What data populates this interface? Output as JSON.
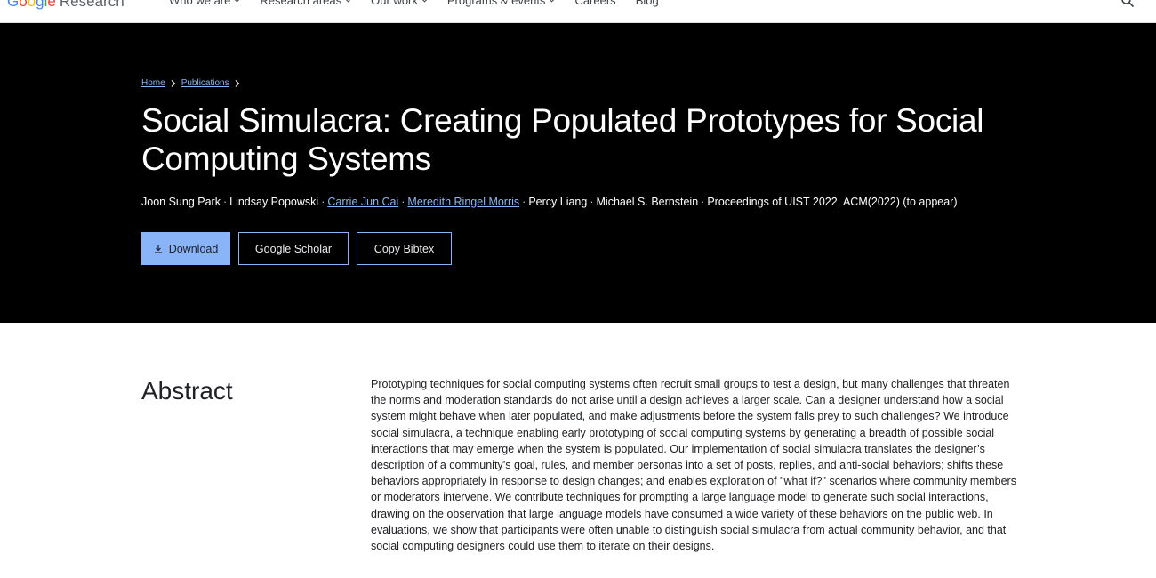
{
  "nav": {
    "logo_google": "Google",
    "logo_research": "Research",
    "links": [
      {
        "label": "Who we are",
        "dropdown": true
      },
      {
        "label": "Research areas",
        "dropdown": true
      },
      {
        "label": "Our work",
        "dropdown": true
      },
      {
        "label": "Programs & events",
        "dropdown": true
      },
      {
        "label": "Careers",
        "dropdown": false
      },
      {
        "label": "Blog",
        "dropdown": false
      }
    ],
    "search_icon": "search-icon"
  },
  "breadcrumb": {
    "home": "Home",
    "publications": "Publications"
  },
  "publication": {
    "title": "Social Simulacra: Creating Populated Prototypes for Social Computing Systems",
    "authors": [
      {
        "name": "Joon Sung Park",
        "link": false
      },
      {
        "name": "Lindsay Popowski",
        "link": false
      },
      {
        "name": "Carrie Jun Cai",
        "link": true
      },
      {
        "name": "Meredith Ringel Morris",
        "link": true
      },
      {
        "name": "Percy Liang",
        "link": false
      },
      {
        "name": "Michael S. Bernstein",
        "link": false
      }
    ],
    "venue": "Proceedings of UIST 2022, ACM(2022) (to appear)",
    "separator": "·"
  },
  "buttons": {
    "download": "Download",
    "scholar": "Google Scholar",
    "bibtex": "Copy Bibtex"
  },
  "abstract": {
    "heading": "Abstract",
    "text": "Prototyping techniques for social computing systems often recruit small groups to test a design, but many challenges that threaten the norms and moderation standards do not arise until a design achieves a larger scale. Can a designer understand how a social system might behave when later populated, and make adjustments before the system falls prey to such challenges? We introduce social simulacra, a technique enabling early prototyping of social computing systems by generating a breadth of possible social interactions that may emerge when the system is populated. Our implementation of social simulacra translates the designer’s description of a community’s goal, rules, and member personas into a set of posts, replies, and anti-social behaviors; shifts these behaviors appropriately in response to design changes; and enables exploration of \"what if?\" scenarios where community members or moderators intervene. We contribute techniques for prompting a large language model to generate such social interactions, drawing on the observation that large language models have consumed a wide variety of these behaviors on the public web. In evaluations, we show that participants were often unable to distinguish social simulacra from actual community behavior, and that social computing designers could use them to iterate on their designs."
  },
  "colors": {
    "hero_bg": "#000000",
    "accent": "#8ab4f8",
    "text": "#202124",
    "google_blue": "#4285f4",
    "google_red": "#ea4335",
    "google_yellow": "#fbbc05",
    "google_green": "#34a853"
  }
}
